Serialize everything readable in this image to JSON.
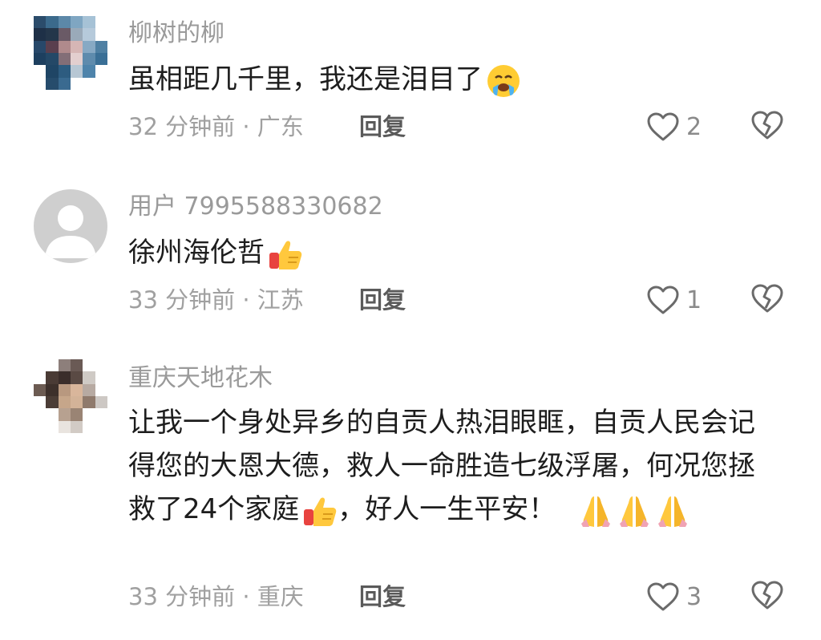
{
  "comments": [
    {
      "username": "柳树的柳",
      "text": "虽相距几千里，我还是泪目了",
      "text_emoji": "loudly-crying-face-emoji",
      "meta": "32 分钟前 · 广东",
      "reply_label": "回复",
      "likes": "2"
    },
    {
      "username": "用户 7995588330682",
      "text": "徐州海伦哲",
      "text_emoji": "thumbs-up-emoji",
      "meta": "33 分钟前 · 江苏",
      "reply_label": "回复",
      "likes": "1"
    },
    {
      "username": "重庆天地花木",
      "text_part1": "让我一个身处异乡的自贡人热泪眼眶，自贡人民会记得您的大恩大德，救人一命胜造七级浮屠，何况您拯救了24个家庭",
      "text_part2": "，好人一生平安！",
      "text_emojis": [
        "thumbs-up-emoji",
        "folded-hands-emoji",
        "folded-hands-emoji",
        "folded-hands-emoji"
      ],
      "meta": "33 分钟前 · 重庆",
      "reply_label": "回复",
      "likes": "3"
    }
  ],
  "icons": {
    "like": "heart-outline-icon",
    "dislike": "broken-heart-icon"
  },
  "colors": {
    "username": "#9a9a9a",
    "text": "#1d1d1d",
    "meta": "#a0a0a0",
    "reply": "#5a5a5a",
    "icon": "#6a6a6a"
  }
}
